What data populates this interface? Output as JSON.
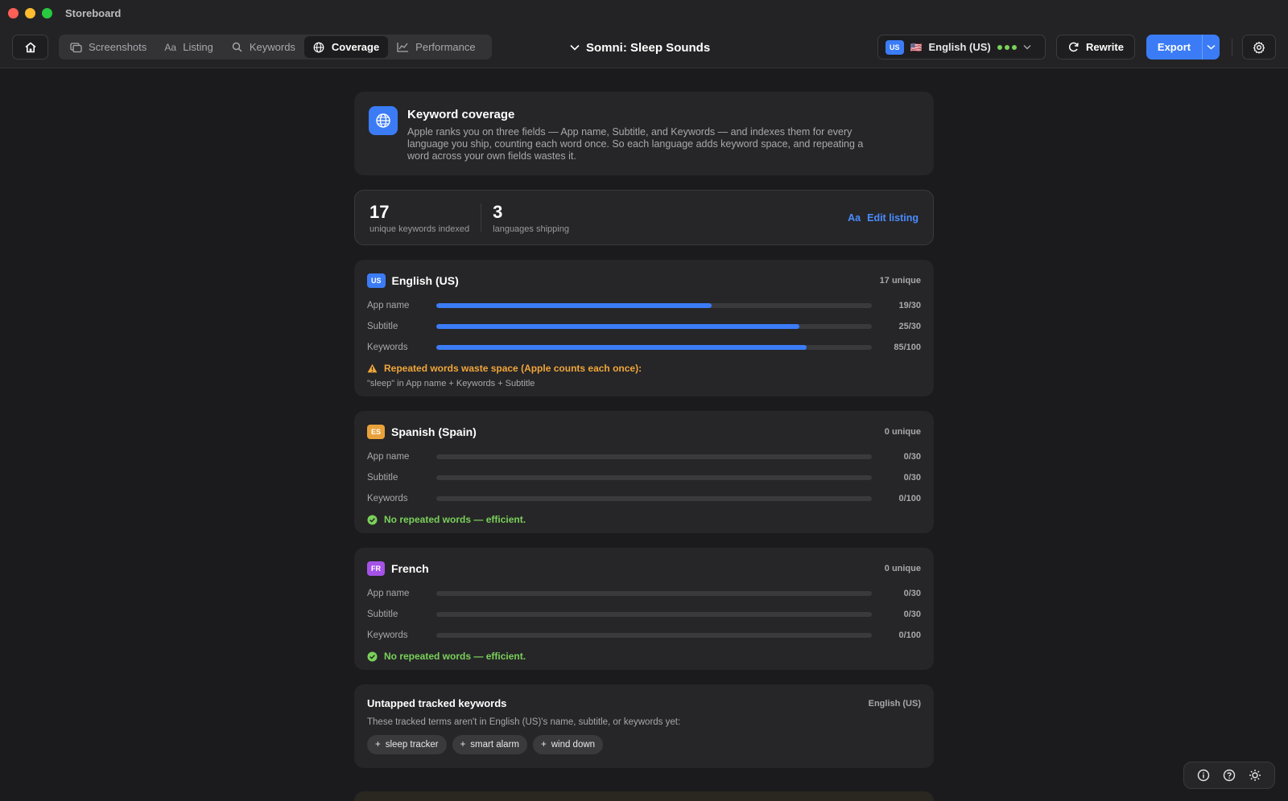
{
  "window": {
    "title": "Storeboard"
  },
  "toolbar": {
    "tabs": [
      {
        "label": "Screenshots",
        "icon": "screenshots-icon"
      },
      {
        "label": "Listing",
        "icon": "text-aa-icon"
      },
      {
        "label": "Keywords",
        "icon": "search-icon"
      },
      {
        "label": "Coverage",
        "icon": "globe-icon"
      },
      {
        "label": "Performance",
        "icon": "chart-line-icon"
      }
    ],
    "active_tab": "Coverage",
    "project_name": "Somni: Sleep Sounds",
    "language": {
      "code": "US",
      "flag": "🇺🇸",
      "label": "English (US)"
    },
    "rewrite_label": "Rewrite",
    "export_label": "Export"
  },
  "intro": {
    "title": "Keyword coverage",
    "text": "Apple ranks you on three fields — App name, Subtitle, and Keywords — and indexes them for every language you ship, counting each word once. So each language adds keyword space, and repeating a word across your own fields wastes it."
  },
  "stats": {
    "keywords_value": "17",
    "keywords_label": "unique keywords indexed",
    "languages_value": "3",
    "languages_label": "languages shipping",
    "edit_prefix": "Aa",
    "edit_label": "Edit listing"
  },
  "languages": [
    {
      "code": "US",
      "name": "English (US)",
      "unique": "17 unique",
      "fields": [
        {
          "label": "App name",
          "count": "19/30",
          "fraction": 0.633
        },
        {
          "label": "Subtitle",
          "count": "25/30",
          "fraction": 0.833
        },
        {
          "label": "Keywords",
          "count": "85/100",
          "fraction": 0.85
        }
      ],
      "note": "Repeated words waste space (Apple counts each once):",
      "note_detail": "\"sleep\" in App name + Keywords + Subtitle"
    },
    {
      "code": "ES",
      "name": "Spanish (Spain)",
      "unique": "0 unique",
      "fields": [
        {
          "label": "App name",
          "count": "0/30",
          "fraction": 0
        },
        {
          "label": "Subtitle",
          "count": "0/30",
          "fraction": 0
        },
        {
          "label": "Keywords",
          "count": "0/100",
          "fraction": 0
        }
      ],
      "note": "No repeated words — efficient."
    },
    {
      "code": "FR",
      "name": "French",
      "unique": "0 unique",
      "fields": [
        {
          "label": "App name",
          "count": "0/30",
          "fraction": 0
        },
        {
          "label": "Subtitle",
          "count": "0/30",
          "fraction": 0
        },
        {
          "label": "Keywords",
          "count": "0/100",
          "fraction": 0
        }
      ],
      "note": "No repeated words — efficient."
    }
  ],
  "untapped": {
    "title": "Untapped tracked keywords",
    "language": "English (US)",
    "description": "These tracked terms aren't in English (US)'s name, subtitle, or keywords yet:",
    "chips": [
      "sleep tracker",
      "smart alarm",
      "wind down"
    ]
  },
  "colors": {
    "accent": "#3b7cf6",
    "warning": "#f0a63a",
    "success": "#7ad15a",
    "es_badge": "#e9a23b",
    "fr_badge": "#a552e6"
  }
}
